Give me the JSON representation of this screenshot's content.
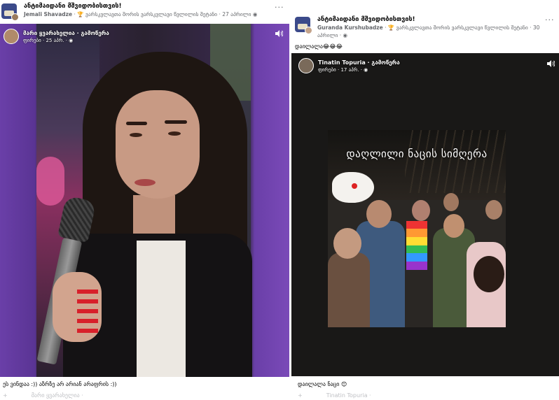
{
  "left_post": {
    "group_name": "ანტიმაიდანი მშვიდობისთვის!",
    "author": "Jemali Shavadze",
    "badge_text": "ვარსკვლავთა შორის ვარსკვლავი წვლილის შეტანი",
    "date": "27 აპრილი",
    "more": "···",
    "video": {
      "author": "მარი ყვარახელია · გამოწერა",
      "sub": "ფირები · 25 აპრ. · ◉",
      "sound_icon": "speaker-icon"
    },
    "caption": "ეს ვინდაა :)) აზრზე არ არიან არაფრის :))",
    "footer_author": "მარი ყვარახელია ·",
    "footer_glyph": "+"
  },
  "right_post": {
    "group_name": "ანტიმაიდანი მშვიდობისთვის!",
    "author": "Guranda Kurshubadze",
    "badge_text": "ვარსკვლავთა შორის ვარსკვლავი წვლილის შეტანი",
    "date_part1": "30",
    "date_part2": "აპრილი ·",
    "more": "···",
    "post_text": "დაილალა😂😂😂",
    "video": {
      "author": "Tinatin Topuria · გამოწერა",
      "sub": "ფირები · 17 აპრ. · ◉",
      "clip_title": "დაღლილი ნაცის სიმღერა",
      "sound_icon": "speaker-icon"
    },
    "caption": "დაილალა ნაცი 😊",
    "footer_author": "Tinatin Topuria ·",
    "footer_glyph": "+"
  }
}
